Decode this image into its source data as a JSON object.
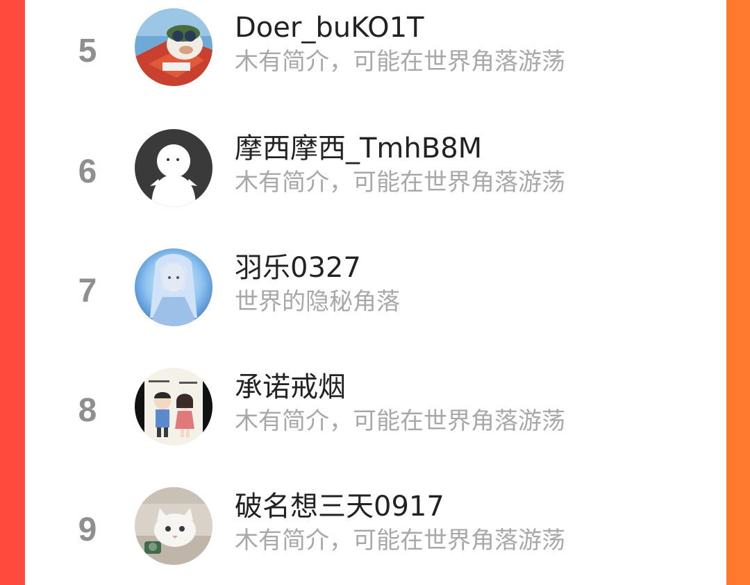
{
  "colors": {
    "accent_left": "#ff4a3d",
    "accent_right": "#ff7a2e",
    "rank_text": "#8f8f8f",
    "name_text": "#222222",
    "bio_text": "#a8a8a8"
  },
  "ranking": {
    "items": [
      {
        "rank": "5",
        "name": "Doer_buKO1T",
        "bio": "木有简介，可能在世界角落游荡",
        "avatar_icon": "cartoon-pilot-avatar"
      },
      {
        "rank": "6",
        "name": "摩西摩西_TmhB8M",
        "bio": "木有简介，可能在世界角落游荡",
        "avatar_icon": "default-user-avatar"
      },
      {
        "rank": "7",
        "name": "羽乐0327",
        "bio": "世界的隐秘角落",
        "avatar_icon": "anime-character-avatar"
      },
      {
        "rank": "8",
        "name": "承诺戒烟",
        "bio": "木有简介，可能在世界角落游荡",
        "avatar_icon": "cartoon-couple-avatar"
      },
      {
        "rank": "9",
        "name": "破名想三天0917",
        "bio": "木有简介，可能在世界角落游荡",
        "avatar_icon": "cat-photo-avatar"
      }
    ]
  }
}
